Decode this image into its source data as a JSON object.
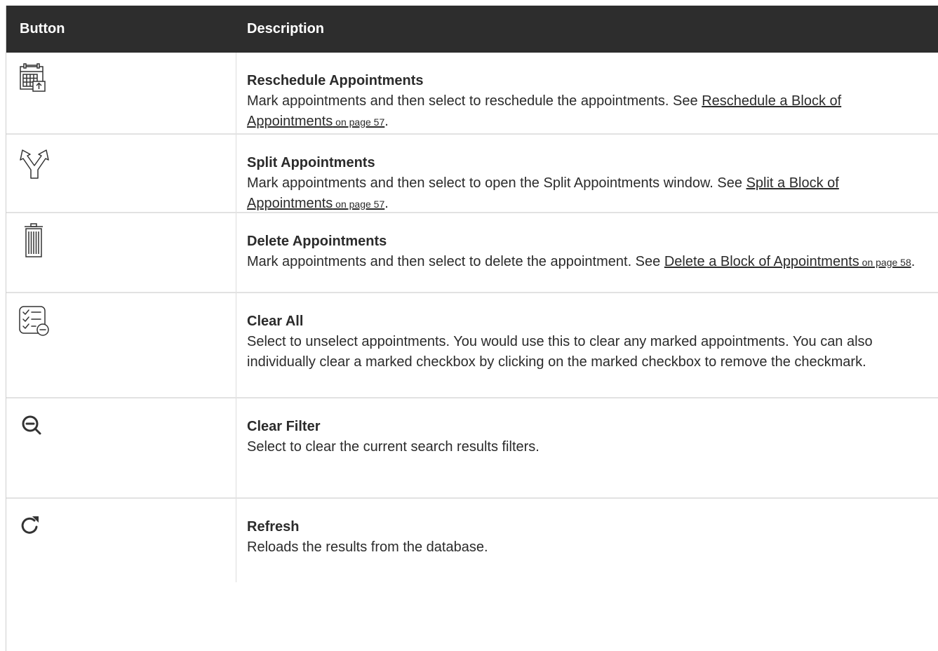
{
  "header": {
    "col_button": "Button",
    "col_description": "Description"
  },
  "rows": [
    {
      "icon": "reschedule-calendar-icon",
      "title": "Reschedule Appointments",
      "desc_before": "Mark appointments and then select to reschedule the appointments. See ",
      "link": "Reschedule a Block of Appointments",
      "page_ref": " on page 57",
      "desc_after": "."
    },
    {
      "icon": "split-arrows-icon",
      "title": "Split Appointments",
      "desc_before": "Mark appointments and then select to open the Split Appointments window. See ",
      "link": "Split a Block of Appointments",
      "page_ref": " on page 57",
      "desc_after": "."
    },
    {
      "icon": "trash-icon",
      "title": "Delete Appointments",
      "desc_before": "Mark appointments and then select to delete the appointment. See ",
      "link": "Delete a Block of Appointments",
      "page_ref": " on page 58",
      "desc_after": "."
    },
    {
      "icon": "clear-all-checklist-icon",
      "title": "Clear All",
      "desc": "Select to unselect appointments. You would use this to clear any marked appointments. You can also individually clear a marked checkbox by clicking on the marked checkbox to remove the checkmark."
    },
    {
      "icon": "zoom-out-icon",
      "title": "Clear Filter",
      "desc": "Select to clear the current search results filters."
    },
    {
      "icon": "refresh-icon",
      "title": "Refresh",
      "desc": "Reloads the results from the database."
    }
  ]
}
